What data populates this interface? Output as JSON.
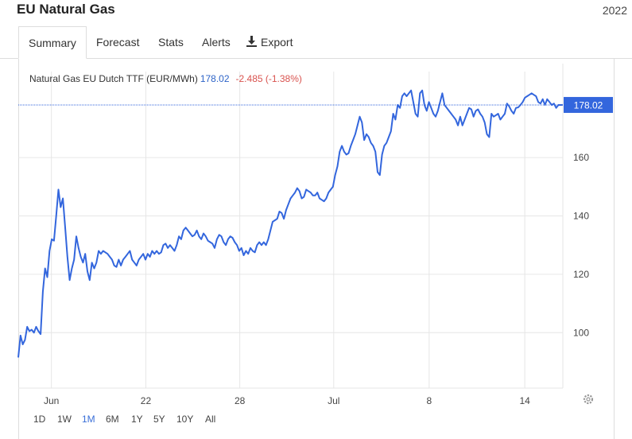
{
  "header": {
    "title": "EU Natural Gas",
    "year": "2022"
  },
  "tabs": [
    {
      "label": "Summary",
      "active": true
    },
    {
      "label": "Forecast",
      "active": false
    },
    {
      "label": "Stats",
      "active": false
    },
    {
      "label": "Alerts",
      "active": false
    },
    {
      "label": "Export",
      "active": false,
      "icon": "download-icon"
    }
  ],
  "quote": {
    "name": "Natural Gas EU Dutch TTF (EUR/MWh)",
    "price": "178.02",
    "change": "-2.485 (-1.38%)"
  },
  "colors": {
    "line": "#3366dd",
    "up": "#3366dd",
    "down": "#d9534f",
    "grid": "#e6e6e6"
  },
  "range_buttons": [
    {
      "label": "1D",
      "active": false
    },
    {
      "label": "1W",
      "active": false
    },
    {
      "label": "1M",
      "active": true
    },
    {
      "label": "6M",
      "active": false
    },
    {
      "label": "1Y",
      "active": false
    },
    {
      "label": "5Y",
      "active": false
    },
    {
      "label": "10Y",
      "active": false
    },
    {
      "label": "All",
      "active": false
    }
  ],
  "settings_icon": "gear-icon",
  "chart_data": {
    "type": "line",
    "title": "",
    "xlabel": "",
    "ylabel": "",
    "ylim": [
      81,
      184
    ],
    "yticks": [
      100,
      120,
      140,
      160
    ],
    "xlim": [
      0,
      222
    ],
    "xticks": [
      {
        "label": "Jun",
        "x": 13.5
      },
      {
        "label": "22",
        "x": 52
      },
      {
        "label": "28",
        "x": 90.3
      },
      {
        "label": "Jul",
        "x": 128.6
      },
      {
        "label": "8",
        "x": 167.5
      },
      {
        "label": "14",
        "x": 206.5
      }
    ],
    "grid": true,
    "last_value_label": "178.02",
    "last_value": 178.02,
    "series": [
      {
        "points": [
          [
            0,
            91.5
          ],
          [
            1,
            99
          ],
          [
            2,
            96
          ],
          [
            3,
            97.5
          ],
          [
            4,
            102
          ],
          [
            5,
            100.5
          ],
          [
            6,
            101
          ],
          [
            7,
            100
          ],
          [
            8,
            102
          ],
          [
            9,
            100.5
          ],
          [
            10,
            99.5
          ],
          [
            11,
            114
          ],
          [
            12,
            122
          ],
          [
            13,
            119
          ],
          [
            14,
            128
          ],
          [
            15,
            132
          ],
          [
            16,
            131.5
          ],
          [
            17,
            140
          ],
          [
            18,
            149
          ],
          [
            19,
            143
          ],
          [
            20,
            146
          ],
          [
            21,
            136
          ],
          [
            22,
            126
          ],
          [
            23,
            118
          ],
          [
            24,
            122
          ],
          [
            25,
            125
          ],
          [
            26,
            133
          ],
          [
            27,
            129
          ],
          [
            28,
            126
          ],
          [
            29,
            124
          ],
          [
            30,
            127
          ],
          [
            31,
            121
          ],
          [
            32,
            118
          ],
          [
            33,
            124
          ],
          [
            34,
            122
          ],
          [
            35,
            124
          ],
          [
            36,
            128
          ],
          [
            37,
            127
          ],
          [
            38,
            128
          ],
          [
            39,
            127.5
          ],
          [
            40,
            127
          ],
          [
            41,
            126
          ],
          [
            42,
            125
          ],
          [
            43,
            123
          ],
          [
            44,
            122.5
          ],
          [
            45,
            125
          ],
          [
            46,
            123
          ],
          [
            47,
            125
          ],
          [
            48,
            126
          ],
          [
            49,
            127
          ],
          [
            50,
            128
          ],
          [
            51,
            125
          ],
          [
            52,
            124
          ],
          [
            53,
            123
          ],
          [
            54,
            125
          ],
          [
            55,
            126
          ],
          [
            56,
            127
          ],
          [
            57,
            125
          ],
          [
            58,
            127
          ],
          [
            59,
            126
          ],
          [
            60,
            128
          ],
          [
            61,
            127
          ],
          [
            62,
            128
          ],
          [
            63,
            127
          ],
          [
            64,
            127.5
          ],
          [
            65,
            130
          ],
          [
            66,
            130.5
          ],
          [
            67,
            129
          ],
          [
            68,
            130
          ],
          [
            69,
            129
          ],
          [
            70,
            128
          ],
          [
            71,
            130
          ],
          [
            72,
            133
          ],
          [
            73,
            132
          ],
          [
            74,
            135
          ],
          [
            75,
            136
          ],
          [
            76,
            135
          ],
          [
            77,
            134
          ],
          [
            78,
            133
          ],
          [
            79,
            133.5
          ],
          [
            80,
            135
          ],
          [
            81,
            133
          ],
          [
            82,
            132
          ],
          [
            83,
            134
          ],
          [
            84,
            133
          ],
          [
            85,
            131.5
          ],
          [
            86,
            131
          ],
          [
            87,
            130.5
          ],
          [
            88,
            129
          ],
          [
            89,
            132
          ],
          [
            90,
            133.5
          ],
          [
            91,
            133
          ],
          [
            92,
            131
          ],
          [
            93,
            130
          ],
          [
            94,
            132
          ],
          [
            95,
            133
          ],
          [
            96,
            132.5
          ],
          [
            97,
            131
          ],
          [
            98,
            130
          ],
          [
            99,
            128
          ],
          [
            100,
            129
          ],
          [
            101,
            126.5
          ],
          [
            102,
            128
          ],
          [
            103,
            127
          ],
          [
            104,
            129
          ],
          [
            105,
            128
          ],
          [
            106,
            127.5
          ],
          [
            107,
            130
          ],
          [
            108,
            131
          ],
          [
            109,
            130
          ],
          [
            110,
            131
          ],
          [
            111,
            130
          ],
          [
            112,
            132
          ],
          [
            113,
            135
          ],
          [
            114,
            138
          ],
          [
            115,
            138.5
          ],
          [
            116,
            139
          ],
          [
            117,
            141.5
          ],
          [
            118,
            141
          ],
          [
            119,
            139
          ],
          [
            120,
            142
          ],
          [
            121,
            144
          ],
          [
            122,
            146
          ],
          [
            123,
            147
          ],
          [
            124,
            148
          ],
          [
            125,
            149.5
          ],
          [
            126,
            148.5
          ],
          [
            127,
            146
          ],
          [
            128,
            146.5
          ],
          [
            129,
            149
          ],
          [
            130,
            148.5
          ],
          [
            131,
            148
          ],
          [
            132,
            147
          ],
          [
            133,
            147
          ],
          [
            134,
            148
          ],
          [
            135,
            146
          ],
          [
            136,
            145.5
          ],
          [
            137,
            145
          ],
          [
            138,
            146
          ],
          [
            139,
            148
          ],
          [
            140,
            149
          ],
          [
            141,
            150
          ],
          [
            142,
            154
          ],
          [
            143,
            157
          ],
          [
            144,
            162
          ],
          [
            145,
            164
          ],
          [
            146,
            162
          ],
          [
            147,
            161
          ],
          [
            148,
            161.5
          ],
          [
            149,
            164
          ],
          [
            150,
            166
          ],
          [
            151,
            168
          ],
          [
            152,
            171
          ],
          [
            153,
            174
          ],
          [
            154,
            172
          ],
          [
            155,
            166
          ],
          [
            156,
            168
          ],
          [
            157,
            167
          ],
          [
            158,
            165
          ],
          [
            159,
            164
          ],
          [
            160,
            162
          ],
          [
            161,
            155
          ],
          [
            162,
            154
          ],
          [
            163,
            161
          ],
          [
            164,
            164
          ],
          [
            165,
            165
          ],
          [
            166,
            167
          ],
          [
            167,
            169
          ],
          [
            168,
            175
          ],
          [
            169,
            173
          ],
          [
            170,
            178
          ],
          [
            171,
            177
          ],
          [
            172,
            181
          ],
          [
            173,
            182
          ],
          [
            174,
            181
          ],
          [
            175,
            182
          ],
          [
            176,
            183
          ],
          [
            177,
            179
          ],
          [
            178,
            175
          ],
          [
            179,
            174
          ],
          [
            180,
            182
          ],
          [
            181,
            183
          ],
          [
            182,
            178
          ],
          [
            183,
            176
          ],
          [
            184,
            179
          ],
          [
            185,
            177
          ],
          [
            186,
            175
          ],
          [
            187,
            174
          ],
          [
            188,
            176
          ],
          [
            189,
            179
          ],
          [
            190,
            182
          ],
          [
            191,
            178
          ],
          [
            192,
            177
          ],
          [
            193,
            176
          ],
          [
            194,
            175
          ],
          [
            195,
            174
          ],
          [
            196,
            173
          ],
          [
            197,
            171
          ],
          [
            198,
            174
          ],
          [
            199,
            171
          ],
          [
            200,
            173
          ],
          [
            201,
            175
          ],
          [
            202,
            177
          ],
          [
            203,
            176.5
          ],
          [
            204,
            174
          ],
          [
            205,
            176
          ],
          [
            206,
            176.5
          ],
          [
            207,
            175
          ],
          [
            208,
            174
          ],
          [
            209,
            172
          ],
          [
            210,
            168
          ],
          [
            211,
            167
          ],
          [
            212,
            175
          ],
          [
            213,
            174
          ],
          [
            214,
            174.5
          ],
          [
            215,
            175
          ],
          [
            216,
            173
          ],
          [
            217,
            174
          ],
          [
            218,
            175
          ],
          [
            219,
            178.5
          ],
          [
            220,
            177.5
          ],
          [
            221,
            176
          ],
          [
            222,
            175
          ],
          [
            223,
            177
          ],
          [
            224,
            177.2
          ],
          [
            225,
            178
          ],
          [
            226,
            179
          ],
          [
            227,
            180.5
          ],
          [
            228,
            181
          ],
          [
            229,
            181.5
          ],
          [
            230,
            182
          ],
          [
            231,
            181.5
          ],
          [
            232,
            181
          ],
          [
            233,
            179
          ],
          [
            234,
            178.5
          ],
          [
            235,
            180
          ],
          [
            236,
            178
          ],
          [
            237,
            180
          ],
          [
            238,
            179
          ],
          [
            239,
            178
          ],
          [
            240,
            178.5
          ],
          [
            241,
            177
          ],
          [
            242,
            178
          ],
          [
            243,
            178
          ],
          [
            244,
            178.02
          ]
        ]
      }
    ]
  }
}
